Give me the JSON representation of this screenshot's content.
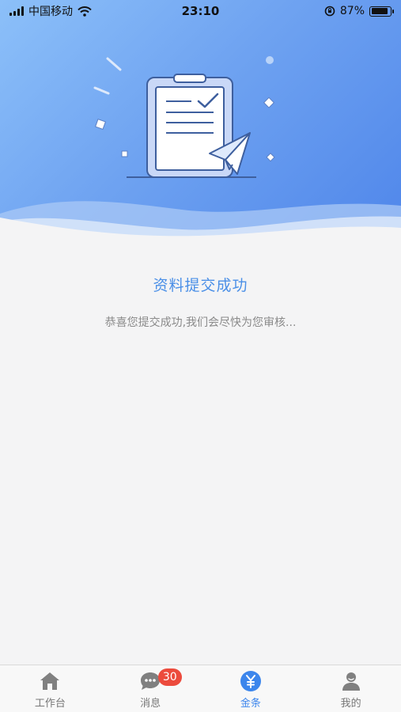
{
  "status_bar": {
    "carrier": "中国移动",
    "time": "23:10",
    "battery_percent_text": "87%",
    "battery_level": 0.87
  },
  "result": {
    "title": "资料提交成功",
    "message": "恭喜您提交成功,我们会尽快为您审核..."
  },
  "tabbar": {
    "items": [
      {
        "label": "工作台",
        "icon": "home-icon",
        "active": false
      },
      {
        "label": "消息",
        "icon": "chat-icon",
        "active": false,
        "badge": "30"
      },
      {
        "label": "金条",
        "icon": "yen-icon",
        "active": true
      },
      {
        "label": "我的",
        "icon": "user-icon",
        "active": false
      }
    ]
  },
  "colors": {
    "accent": "#3c86ec",
    "header_gradient_start": "#8cc0f9",
    "header_gradient_end": "#4f86ea",
    "badge": "#ec4b3d",
    "title_text": "#4a8fe7",
    "body_text": "#8a8a8a"
  }
}
